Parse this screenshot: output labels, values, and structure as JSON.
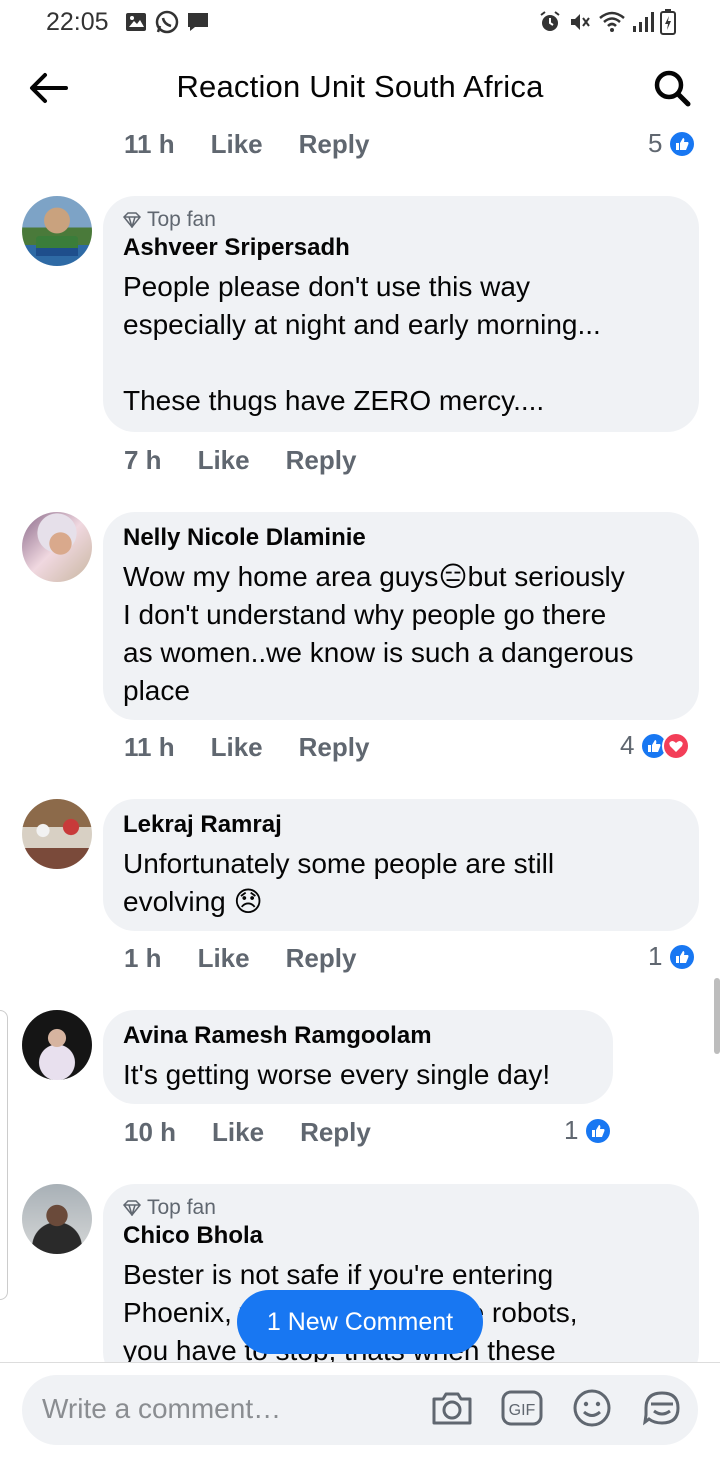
{
  "status_bar": {
    "time": "22:05",
    "left_icons": [
      "image-icon",
      "whatsapp-icon",
      "message-icon"
    ],
    "right_icons": [
      "alarm-icon",
      "mute-icon",
      "wifi-icon",
      "signal-icon",
      "battery-icon"
    ]
  },
  "header": {
    "title": "Reaction Unit South Africa"
  },
  "top_meta": {
    "time": "11 h",
    "like": "Like",
    "reply": "Reply",
    "reaction_count": "5"
  },
  "comments": [
    {
      "badge": "Top fan",
      "author": "Ashveer Sripersadh",
      "text": "People please don't use this way\nespecially at night and early morning...\n\nThese thugs have ZERO mercy....",
      "time": "7 h",
      "like": "Like",
      "reply": "Reply",
      "reaction_count": ""
    },
    {
      "badge": "",
      "author": "Nelly Nicole Dlaminie",
      "text": "Wow my home area guys😑but seriously\nI don't understand why people go there\nas women..we know is such a dangerous\nplace",
      "time": "11 h",
      "like": "Like",
      "reply": "Reply",
      "reaction_count": "4"
    },
    {
      "badge": "",
      "author": "Lekraj Ramraj",
      "text": "Unfortunately some people are still\nevolving 😞",
      "time": "1 h",
      "like": "Like",
      "reply": "Reply",
      "reaction_count": "1"
    },
    {
      "badge": "",
      "author": "Avina Ramesh Ramgoolam",
      "text": "It's getting worse every single day!",
      "time": "10 h",
      "like": "Like",
      "reply": "Reply",
      "reaction_count": "1"
    },
    {
      "badge": "Top fan",
      "author": "Chico Bhola",
      "text": "Bester is not safe if you're entering\nPhoenix, when you get to the robots,\nyou have to stop, thats when these",
      "time": "",
      "like": "",
      "reply": "",
      "reaction_count": ""
    }
  ],
  "new_comment_pill": "1 New Comment",
  "composer": {
    "placeholder": "Write a comment…",
    "icons": [
      "camera-icon",
      "gif-icon",
      "emoji-icon",
      "sticker-icon"
    ],
    "gif_label": "GIF"
  },
  "colors": {
    "accent": "#1877f2",
    "bubble": "#f0f2f5",
    "meta": "#606770",
    "love": "#f33e58"
  }
}
